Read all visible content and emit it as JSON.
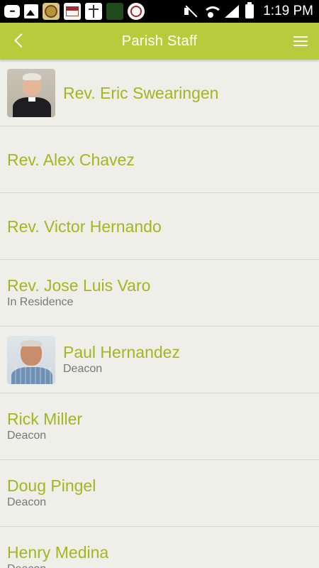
{
  "status_bar": {
    "time": "1:19 PM",
    "notification_icons": [
      "message-icon",
      "gallery-icon",
      "seal-icon",
      "church-logo-icon",
      "cross-logo-icon",
      "green-app-icon",
      "round-seal-icon"
    ],
    "system_icons": [
      "mute-icon",
      "wifi-icon",
      "signal-icon",
      "battery-icon"
    ]
  },
  "app_bar": {
    "title": "Parish Staff",
    "back_icon": "chevron-left-icon",
    "menu_icon": "hamburger-menu-icon",
    "color": "#b6cc3d"
  },
  "staff": [
    {
      "name": "Rev. Eric Swearingen",
      "role": "",
      "has_photo": true
    },
    {
      "name": "Rev. Alex Chavez",
      "role": "",
      "has_photo": false
    },
    {
      "name": "Rev. Victor Hernando",
      "role": "",
      "has_photo": false
    },
    {
      "name": "Rev. Jose Luis Varo",
      "role": "In Residence",
      "has_photo": false
    },
    {
      "name": "Paul Hernandez",
      "role": "Deacon",
      "has_photo": true
    },
    {
      "name": "Rick Miller",
      "role": "Deacon",
      "has_photo": false
    },
    {
      "name": "Doug Pingel",
      "role": "Deacon",
      "has_photo": false
    },
    {
      "name": "Henry Medina",
      "role": "Deacon",
      "has_photo": false
    }
  ],
  "colors": {
    "accent": "#b6cc3d",
    "name_text": "#a4b51f",
    "role_text": "#777777",
    "background": "#efefea",
    "divider": "#d6d6d0"
  }
}
